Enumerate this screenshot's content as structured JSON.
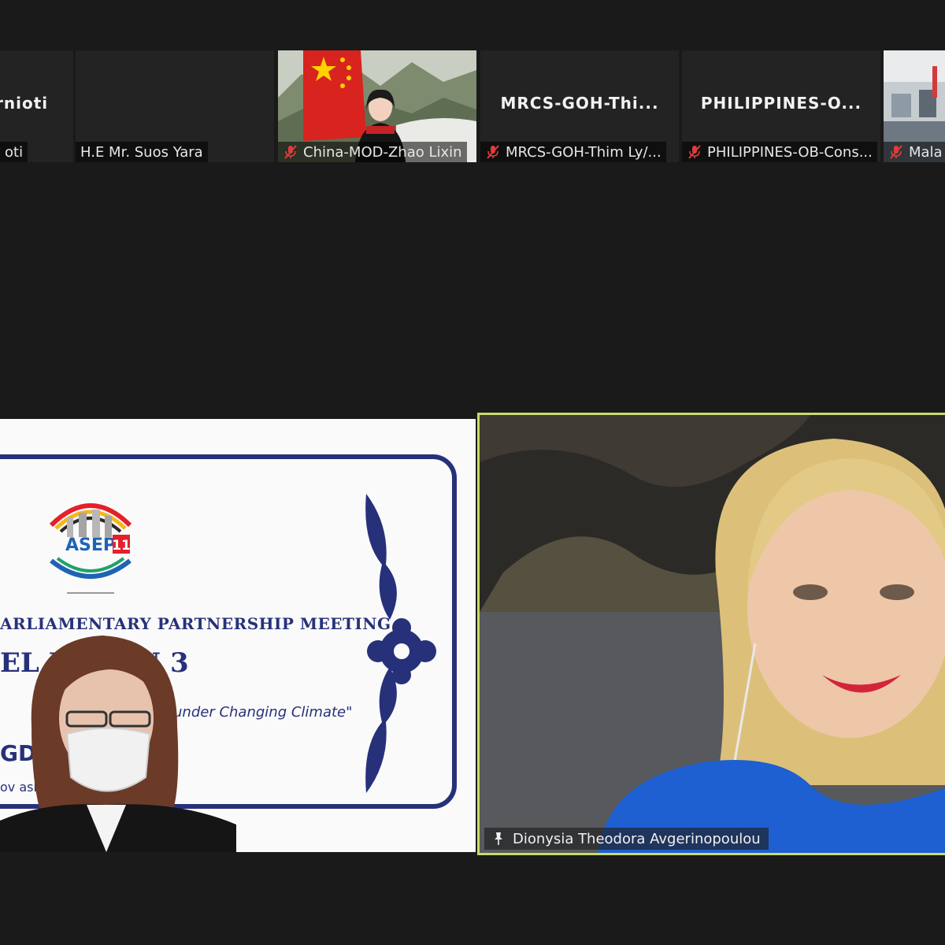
{
  "participants_strip": [
    {
      "id": "p1",
      "big_name": "rnioti",
      "label": "oti",
      "muted": false
    },
    {
      "id": "p2",
      "big_name": "",
      "label": "H.E Mr. Suos Yara",
      "muted": false
    },
    {
      "id": "p3",
      "big_name": "",
      "label": "China-MOD-Zhao Lixin",
      "muted": true
    },
    {
      "id": "p4",
      "big_name": "MRCS-GOH-Thi...",
      "label": "MRCS-GOH-Thim Ly/...",
      "muted": true
    },
    {
      "id": "p5",
      "big_name": "PHILIPPINES-O...",
      "label": "PHILIPPINES-OB-Cons...",
      "muted": true
    },
    {
      "id": "p6",
      "big_name": "",
      "label": "Mala",
      "muted": true
    }
  ],
  "shared_screen": {
    "logo_text": "ASEP 11",
    "meeting_line": "ARLIAMENTARY PARTNERSHIP MEETING",
    "session_line": "EL D     SION 3",
    "theme_line": "under Changing Climate\"",
    "host_line": "GDO        ODIA",
    "city_line": "ov                          ash."
  },
  "active_speaker": {
    "name": "Dionysia Theodora Avgerinopoulou",
    "pinned": true
  },
  "colors": {
    "background": "#1a1a1a",
    "tile": "#232323",
    "active_border": "#c7dc6b",
    "slide_navy": "#27317a",
    "mute_red": "#e03b3b"
  }
}
